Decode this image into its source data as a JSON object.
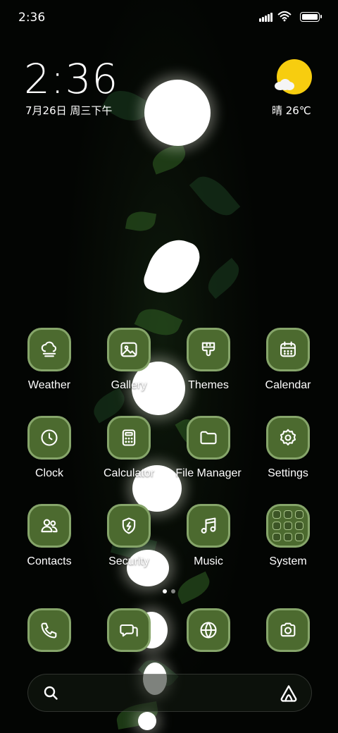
{
  "status_bar": {
    "time": "2:36"
  },
  "clock_widget": {
    "time": "2:36",
    "date": "7月26日 周三下午"
  },
  "weather_widget": {
    "condition_temp": "晴 26℃"
  },
  "apps": [
    {
      "label": "Weather",
      "icon": "cloud-fog-icon"
    },
    {
      "label": "Gallery",
      "icon": "image-icon"
    },
    {
      "label": "Themes",
      "icon": "brush-icon"
    },
    {
      "label": "Calendar",
      "icon": "calendar-icon"
    },
    {
      "label": "Clock",
      "icon": "clock-icon"
    },
    {
      "label": "Calculator",
      "icon": "calculator-icon"
    },
    {
      "label": "File Manager",
      "icon": "folder-icon"
    },
    {
      "label": "Settings",
      "icon": "gear-icon"
    },
    {
      "label": "Contacts",
      "icon": "people-icon"
    },
    {
      "label": "Security",
      "icon": "shield-bolt-icon"
    },
    {
      "label": "Music",
      "icon": "music-note-icon"
    },
    {
      "label": "System",
      "icon": "folder-grid-icon"
    }
  ],
  "dock": [
    {
      "name": "phone",
      "icon": "phone-icon"
    },
    {
      "name": "messages",
      "icon": "message-icon"
    },
    {
      "name": "browser",
      "icon": "globe-icon"
    },
    {
      "name": "camera",
      "icon": "camera-icon"
    }
  ],
  "page_indicator": {
    "pages": 2,
    "current": 1
  },
  "colors": {
    "tile_bg": "#4c6a2f",
    "tile_border": "#86a56a",
    "sun": "#f7cd0f"
  }
}
